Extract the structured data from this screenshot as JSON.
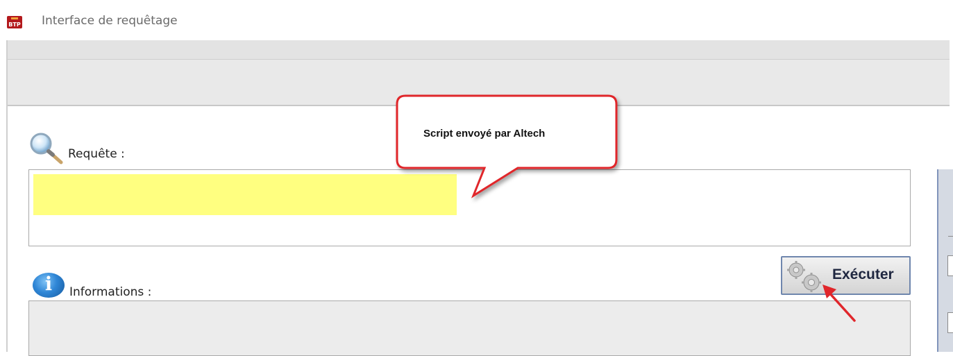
{
  "window": {
    "title": "Interface de requêtage",
    "icon_text": "BTP"
  },
  "requete": {
    "label": "Requête :",
    "icon": "magnifier-icon",
    "highlight_color": "#ffff80"
  },
  "informations": {
    "label": "Informations :",
    "icon": "info-icon"
  },
  "execute_button": {
    "label": "Exécuter",
    "icon": "gears-icon"
  },
  "callout": {
    "text": "Script envoyé par Altech",
    "border_color": "#e0262b"
  },
  "annotation_arrow": {
    "color": "#e0262b"
  }
}
